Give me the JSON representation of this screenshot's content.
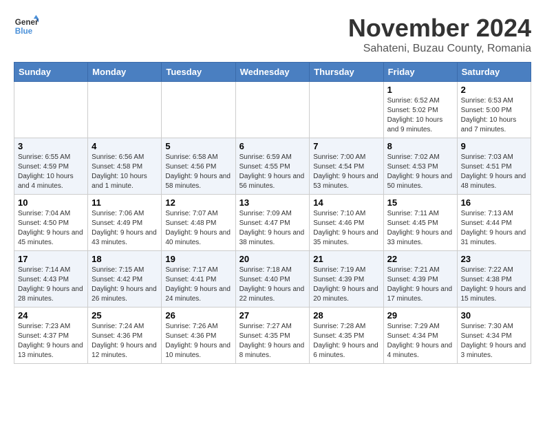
{
  "logo": {
    "line1": "General",
    "line2": "Blue"
  },
  "title": "November 2024",
  "subtitle": "Sahateni, Buzau County, Romania",
  "header_days": [
    "Sunday",
    "Monday",
    "Tuesday",
    "Wednesday",
    "Thursday",
    "Friday",
    "Saturday"
  ],
  "weeks": [
    [
      {
        "day": "",
        "info": ""
      },
      {
        "day": "",
        "info": ""
      },
      {
        "day": "",
        "info": ""
      },
      {
        "day": "",
        "info": ""
      },
      {
        "day": "",
        "info": ""
      },
      {
        "day": "1",
        "info": "Sunrise: 6:52 AM\nSunset: 5:02 PM\nDaylight: 10 hours and 9 minutes."
      },
      {
        "day": "2",
        "info": "Sunrise: 6:53 AM\nSunset: 5:00 PM\nDaylight: 10 hours and 7 minutes."
      }
    ],
    [
      {
        "day": "3",
        "info": "Sunrise: 6:55 AM\nSunset: 4:59 PM\nDaylight: 10 hours and 4 minutes."
      },
      {
        "day": "4",
        "info": "Sunrise: 6:56 AM\nSunset: 4:58 PM\nDaylight: 10 hours and 1 minute."
      },
      {
        "day": "5",
        "info": "Sunrise: 6:58 AM\nSunset: 4:56 PM\nDaylight: 9 hours and 58 minutes."
      },
      {
        "day": "6",
        "info": "Sunrise: 6:59 AM\nSunset: 4:55 PM\nDaylight: 9 hours and 56 minutes."
      },
      {
        "day": "7",
        "info": "Sunrise: 7:00 AM\nSunset: 4:54 PM\nDaylight: 9 hours and 53 minutes."
      },
      {
        "day": "8",
        "info": "Sunrise: 7:02 AM\nSunset: 4:53 PM\nDaylight: 9 hours and 50 minutes."
      },
      {
        "day": "9",
        "info": "Sunrise: 7:03 AM\nSunset: 4:51 PM\nDaylight: 9 hours and 48 minutes."
      }
    ],
    [
      {
        "day": "10",
        "info": "Sunrise: 7:04 AM\nSunset: 4:50 PM\nDaylight: 9 hours and 45 minutes."
      },
      {
        "day": "11",
        "info": "Sunrise: 7:06 AM\nSunset: 4:49 PM\nDaylight: 9 hours and 43 minutes."
      },
      {
        "day": "12",
        "info": "Sunrise: 7:07 AM\nSunset: 4:48 PM\nDaylight: 9 hours and 40 minutes."
      },
      {
        "day": "13",
        "info": "Sunrise: 7:09 AM\nSunset: 4:47 PM\nDaylight: 9 hours and 38 minutes."
      },
      {
        "day": "14",
        "info": "Sunrise: 7:10 AM\nSunset: 4:46 PM\nDaylight: 9 hours and 35 minutes."
      },
      {
        "day": "15",
        "info": "Sunrise: 7:11 AM\nSunset: 4:45 PM\nDaylight: 9 hours and 33 minutes."
      },
      {
        "day": "16",
        "info": "Sunrise: 7:13 AM\nSunset: 4:44 PM\nDaylight: 9 hours and 31 minutes."
      }
    ],
    [
      {
        "day": "17",
        "info": "Sunrise: 7:14 AM\nSunset: 4:43 PM\nDaylight: 9 hours and 28 minutes."
      },
      {
        "day": "18",
        "info": "Sunrise: 7:15 AM\nSunset: 4:42 PM\nDaylight: 9 hours and 26 minutes."
      },
      {
        "day": "19",
        "info": "Sunrise: 7:17 AM\nSunset: 4:41 PM\nDaylight: 9 hours and 24 minutes."
      },
      {
        "day": "20",
        "info": "Sunrise: 7:18 AM\nSunset: 4:40 PM\nDaylight: 9 hours and 22 minutes."
      },
      {
        "day": "21",
        "info": "Sunrise: 7:19 AM\nSunset: 4:39 PM\nDaylight: 9 hours and 20 minutes."
      },
      {
        "day": "22",
        "info": "Sunrise: 7:21 AM\nSunset: 4:39 PM\nDaylight: 9 hours and 17 minutes."
      },
      {
        "day": "23",
        "info": "Sunrise: 7:22 AM\nSunset: 4:38 PM\nDaylight: 9 hours and 15 minutes."
      }
    ],
    [
      {
        "day": "24",
        "info": "Sunrise: 7:23 AM\nSunset: 4:37 PM\nDaylight: 9 hours and 13 minutes."
      },
      {
        "day": "25",
        "info": "Sunrise: 7:24 AM\nSunset: 4:36 PM\nDaylight: 9 hours and 12 minutes."
      },
      {
        "day": "26",
        "info": "Sunrise: 7:26 AM\nSunset: 4:36 PM\nDaylight: 9 hours and 10 minutes."
      },
      {
        "day": "27",
        "info": "Sunrise: 7:27 AM\nSunset: 4:35 PM\nDaylight: 9 hours and 8 minutes."
      },
      {
        "day": "28",
        "info": "Sunrise: 7:28 AM\nSunset: 4:35 PM\nDaylight: 9 hours and 6 minutes."
      },
      {
        "day": "29",
        "info": "Sunrise: 7:29 AM\nSunset: 4:34 PM\nDaylight: 9 hours and 4 minutes."
      },
      {
        "day": "30",
        "info": "Sunrise: 7:30 AM\nSunset: 4:34 PM\nDaylight: 9 hours and 3 minutes."
      }
    ]
  ]
}
